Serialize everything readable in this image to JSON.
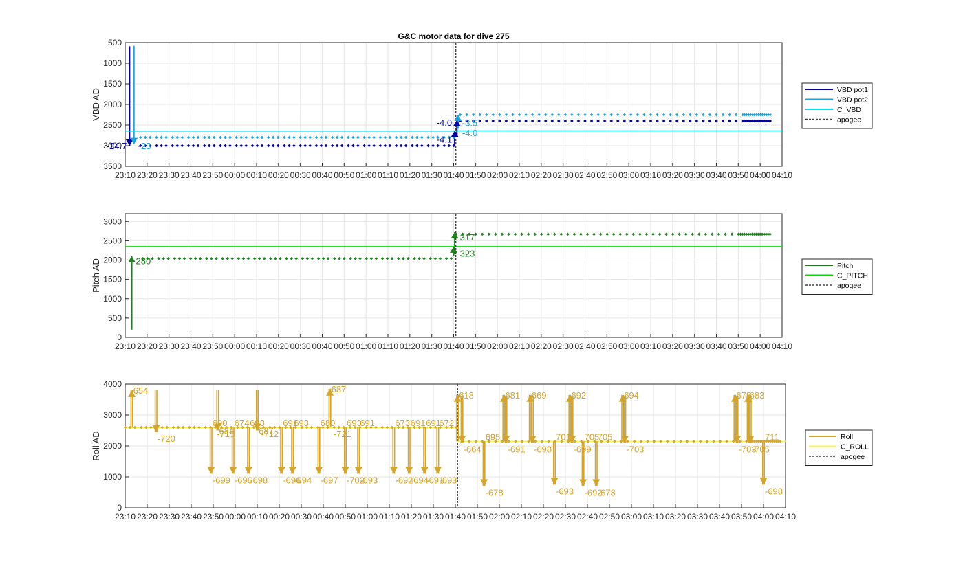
{
  "chart_data": [
    {
      "type": "line",
      "title": "G&C motor data for dive 275",
      "xlabel": "",
      "ylabel": "VBD AD",
      "xlim": [
        "23:10",
        "04:10"
      ],
      "xticks": [
        "23:10",
        "23:20",
        "23:30",
        "23:40",
        "23:50",
        "00:00",
        "00:10",
        "00:20",
        "00:30",
        "00:40",
        "00:50",
        "01:00",
        "01:10",
        "01:20",
        "01:30",
        "01:40",
        "01:50",
        "02:00",
        "02:10",
        "02:20",
        "02:30",
        "02:40",
        "02:50",
        "03:00",
        "03:10",
        "03:20",
        "03:30",
        "03:40",
        "03:50",
        "04:00",
        "04:10"
      ],
      "ylim": [
        500,
        3500
      ],
      "y_reversed": true,
      "yticks": [
        "500",
        "1000",
        "1500",
        "2000",
        "2500",
        "3000",
        "3500"
      ],
      "grid": true,
      "legend": [
        "VBD pot1",
        "VBD pot2",
        "C_VBD",
        "apogee"
      ],
      "legend_position": "outside-right",
      "apogee": "01:41",
      "series": [
        {
          "name": "VBD pot1",
          "color": "#0000a8",
          "segments": [
            {
              "x": [
                "23:12",
                "23:12"
              ],
              "y": [
                590,
                3000
              ]
            },
            {
              "x": [
                "01:40.5",
                "01:40.5"
              ],
              "y": [
                2990,
                2640
              ]
            },
            {
              "x": [
                "01:41.5",
                "01:41.5"
              ],
              "y": [
                2780,
                2380
              ]
            }
          ],
          "markers": {
            "x_start": "23:17",
            "x_end": "04:05",
            "y_before": 3000,
            "y_after": 2400
          }
        },
        {
          "name": "VBD pot2",
          "color": "#1aa5dc",
          "segments": [
            {
              "x": [
                "23:14",
                "23:14"
              ],
              "y": [
                580,
                2960
              ]
            },
            {
              "x": [
                "01:42",
                "01:42"
              ],
              "y": [
                2590,
                2250
              ]
            }
          ],
          "markers": {
            "x_start": "23:17",
            "x_end": "04:05",
            "y_before": 2800,
            "y_after": 2250
          }
        },
        {
          "name": "C_VBD",
          "color": "#00e6e6",
          "segments": [
            {
              "x": [
                "23:10",
                "01:41"
              ],
              "y": [
                2650,
                2650
              ]
            },
            {
              "x": [
                "01:41",
                "04:10"
              ],
              "y": [
                2640,
                2640
              ]
            }
          ]
        }
      ],
      "annotations": [
        {
          "text": "-24.7",
          "x": "23:12",
          "y": 3000,
          "color": "#0000a8"
        },
        {
          "text": "-23",
          "x": "23:14",
          "y": 3000,
          "color": "#1aa5dc"
        },
        {
          "text": "-4.1",
          "x": "01:40.5",
          "y": 2840,
          "color": "#0000a8"
        },
        {
          "text": "-4.0",
          "x": "01:40.5",
          "y": 2430,
          "color": "#0000a8"
        },
        {
          "text": "-3.5",
          "x": "01:42",
          "y": 2440,
          "color": "#1aa5dc"
        },
        {
          "text": "-4.0",
          "x": "01:42",
          "y": 2680,
          "color": "#1aa5dc"
        }
      ]
    },
    {
      "type": "line",
      "title": "",
      "xlabel": "",
      "ylabel": "Pitch AD",
      "xlim": [
        "23:10",
        "04:10"
      ],
      "xticks": [
        "23:10",
        "23:20",
        "23:30",
        "23:40",
        "23:50",
        "00:00",
        "00:10",
        "00:20",
        "00:30",
        "00:40",
        "00:50",
        "01:00",
        "01:10",
        "01:20",
        "01:30",
        "01:40",
        "01:50",
        "02:00",
        "02:10",
        "02:20",
        "02:30",
        "02:40",
        "02:50",
        "03:00",
        "03:10",
        "03:20",
        "03:30",
        "03:40",
        "03:50",
        "04:00",
        "04:10"
      ],
      "ylim": [
        0,
        3200
      ],
      "yticks": [
        "0",
        "500",
        "1000",
        "1500",
        "2000",
        "2500",
        "3000"
      ],
      "grid": true,
      "legend": [
        "Pitch",
        "C_PITCH",
        "apogee"
      ],
      "legend_position": "outside-right",
      "apogee": "01:41",
      "series": [
        {
          "name": "Pitch",
          "color": "#208020",
          "segments": [
            {
              "x": [
                "23:13",
                "23:13"
              ],
              "y": [
                200,
                2100
              ]
            },
            {
              "x": [
                "01:40",
                "01:40"
              ],
              "y": [
                2100,
                2350
              ]
            },
            {
              "x": [
                "01:40.5",
                "01:40.5"
              ],
              "y": [
                2150,
                2720
              ]
            }
          ],
          "markers": {
            "x_start": "23:18",
            "x_end": "04:05",
            "y_before": 2040,
            "y_after": 2670
          }
        },
        {
          "name": "C_PITCH",
          "color": "#00dd00",
          "segments": [
            {
              "x": [
                "23:10",
                "04:10"
              ],
              "y": [
                2350,
                2350
              ]
            }
          ]
        }
      ],
      "annotations": [
        {
          "text": "280",
          "x": "23:13",
          "y": 1980,
          "color": "#208020"
        },
        {
          "text": "317",
          "x": "01:41",
          "y": 2600,
          "color": "#208020"
        },
        {
          "text": "323",
          "x": "01:41",
          "y": 2180,
          "color": "#208020"
        }
      ]
    },
    {
      "type": "line",
      "title": "",
      "xlabel": "",
      "ylabel": "Roll AD",
      "xlim": [
        "23:10",
        "04:10"
      ],
      "xticks": [
        "23:10",
        "23:20",
        "23:30",
        "23:40",
        "23:50",
        "00:00",
        "00:10",
        "00:20",
        "00:30",
        "00:40",
        "00:50",
        "01:00",
        "01:10",
        "01:20",
        "01:30",
        "01:40",
        "01:50",
        "02:00",
        "02:10",
        "02:20",
        "02:30",
        "02:40",
        "02:50",
        "03:00",
        "03:10",
        "03:20",
        "03:30",
        "03:40",
        "03:50",
        "04:00",
        "04:10"
      ],
      "ylim": [
        0,
        4000
      ],
      "yticks": [
        "0",
        "1000",
        "2000",
        "3000",
        "4000"
      ],
      "grid": true,
      "legend": [
        "Roll",
        "C_ROLL",
        "apogee"
      ],
      "legend_position": "outside-right",
      "apogee": "01:41",
      "series": [
        {
          "name": "Roll",
          "color": "#d4a52a",
          "markers": {
            "x_start": "23:10",
            "x_end": "04:08",
            "y_before": 2600,
            "y_after": 2150
          }
        },
        {
          "name": "C_ROLL",
          "color": "#f5f542",
          "segments": [
            {
              "x": [
                "23:10",
                "01:41"
              ],
              "y": [
                2590,
                2590
              ]
            },
            {
              "x": [
                "01:41",
                "04:10"
              ],
              "y": [
                2150,
                2150
              ]
            }
          ]
        }
      ],
      "roll_arrows": [
        {
          "x": "23:13",
          "base": 2600,
          "tip": 3800,
          "label": "654"
        },
        {
          "x": "23:24",
          "base": 3800,
          "tip": 2450,
          "label": "-720"
        },
        {
          "x": "23:52",
          "base": 3800,
          "tip": 2500,
          "label": "684"
        },
        {
          "x": "00:10",
          "base": 3800,
          "tip": 2500,
          "label": "687"
        },
        {
          "x": "00:43",
          "base": 2600,
          "tip": 3850,
          "label": "687"
        },
        {
          "x": "23:49",
          "base": 2600,
          "tip": 1100,
          "label": "690",
          "label2": "-699"
        },
        {
          "x": "23:51",
          "base": 2600,
          "tip": 2600,
          "label": "-715"
        },
        {
          "x": "23:59",
          "base": 2600,
          "tip": 1100,
          "label": "674",
          "label2": "-696"
        },
        {
          "x": "00:06",
          "base": 2600,
          "tip": 1100,
          "label": "693",
          "label2": "-698"
        },
        {
          "x": "00:21",
          "base": 2600,
          "tip": 1100,
          "label": "691",
          "label2": "-696"
        },
        {
          "x": "00:11",
          "base": 2600,
          "tip": 2600,
          "label": "-712"
        },
        {
          "x": "00:26",
          "base": 2600,
          "tip": 1100,
          "label": "693",
          "label2": "-694"
        },
        {
          "x": "00:38",
          "base": 2600,
          "tip": 1100,
          "label": "680",
          "label2": "-697"
        },
        {
          "x": "00:44",
          "base": 2600,
          "tip": 2600,
          "label": "-721"
        },
        {
          "x": "00:50",
          "base": 2600,
          "tip": 1100,
          "label": "693",
          "label2": "-702"
        },
        {
          "x": "00:56",
          "base": 2600,
          "tip": 1100,
          "label": "691",
          "label2": "-693"
        },
        {
          "x": "01:12",
          "base": 2600,
          "tip": 1100,
          "label": "673",
          "label2": "-692"
        },
        {
          "x": "01:19",
          "base": 2600,
          "tip": 1100,
          "label": "691",
          "label2": "-694"
        },
        {
          "x": "01:26",
          "base": 2600,
          "tip": 1100,
          "label": "691",
          "label2": "-691"
        },
        {
          "x": "01:32",
          "base": 2600,
          "tip": 1100,
          "label": "672",
          "label2": "-693"
        },
        {
          "x": "01:41",
          "base": 2150,
          "tip": 3650,
          "label": "618"
        },
        {
          "x": "01:43",
          "base": 3600,
          "tip": 2100,
          "label": "-664"
        },
        {
          "x": "01:53",
          "base": 2150,
          "tip": 700,
          "label": "695",
          "label2": "-678"
        },
        {
          "x": "02:02",
          "base": 2150,
          "tip": 3650,
          "label": "681"
        },
        {
          "x": "02:03",
          "base": 3600,
          "tip": 2100,
          "label": "-691"
        },
        {
          "x": "02:14",
          "base": 2150,
          "tip": 3650,
          "label": "669"
        },
        {
          "x": "02:15",
          "base": 3600,
          "tip": 2100,
          "label": "-698"
        },
        {
          "x": "02:25",
          "base": 2150,
          "tip": 750,
          "label": "701",
          "label2": "-693"
        },
        {
          "x": "02:32",
          "base": 2150,
          "tip": 3650,
          "label": "692"
        },
        {
          "x": "02:33",
          "base": 3600,
          "tip": 2100,
          "label": "-699"
        },
        {
          "x": "02:38",
          "base": 2150,
          "tip": 700,
          "label": "705",
          "label2": "-692"
        },
        {
          "x": "02:44",
          "base": 2150,
          "tip": 700,
          "label": "705",
          "label2": "-678"
        },
        {
          "x": "02:56",
          "base": 2150,
          "tip": 3650,
          "label": "694"
        },
        {
          "x": "02:57",
          "base": 3600,
          "tip": 2100,
          "label": "-703"
        },
        {
          "x": "03:47",
          "base": 2150,
          "tip": 3650,
          "label": "678"
        },
        {
          "x": "03:48",
          "base": 3600,
          "tip": 2100,
          "label": "-703"
        },
        {
          "x": "03:53",
          "base": 2150,
          "tip": 3650,
          "label": "683"
        },
        {
          "x": "03:54",
          "base": 3600,
          "tip": 2100,
          "label": "-705"
        },
        {
          "x": "04:00",
          "base": 2150,
          "tip": 750,
          "label": "711",
          "label2": "-698"
        }
      ]
    }
  ]
}
